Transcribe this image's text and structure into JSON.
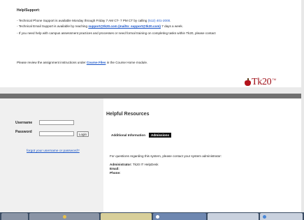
{
  "support": {
    "title": "Help/Support:",
    "phone_prefix": "- Technical Phone Support is available Monday through Friday 7 AM CT- 7 PM CT by calling ",
    "phone_number": "(512) 401-2000",
    "phone_suffix": ".",
    "email_prefix": "- Technical Email Support is available by reaching ",
    "email_link": "support@tk20.com (mailto: support@tk20.com)",
    "email_suffix": " 7 days a week.",
    "campus_text": "- If you need help with campus assessment practices and processes or need formal training on completing tasks within Tk20, please contact"
  },
  "review": {
    "prefix": "Please review the assignment instructions under ",
    "link": "Course Files",
    "suffix": " in the Course Home module."
  },
  "brand": {
    "name": "Tk20",
    "tm": "TM"
  },
  "login": {
    "username_label": "Username",
    "password_label": "Password",
    "username_value": "",
    "password_value": "",
    "login_button": "Login",
    "forgot_link": "forgot your username or password?"
  },
  "resources": {
    "title": "Helpful Resources",
    "tabs": [
      "Additional Information",
      "Admissions"
    ],
    "questions": "For questions regarding this system, please contact your system administrator:",
    "admin_label": "Administrator:",
    "admin_value": " Tk20 IT HelpDesk",
    "email_label": "Email:",
    "phone_label": "Phone:"
  },
  "colors": {
    "link": "#1a55c8",
    "brand": "#a01018",
    "active_tab_bg": "#111111"
  }
}
